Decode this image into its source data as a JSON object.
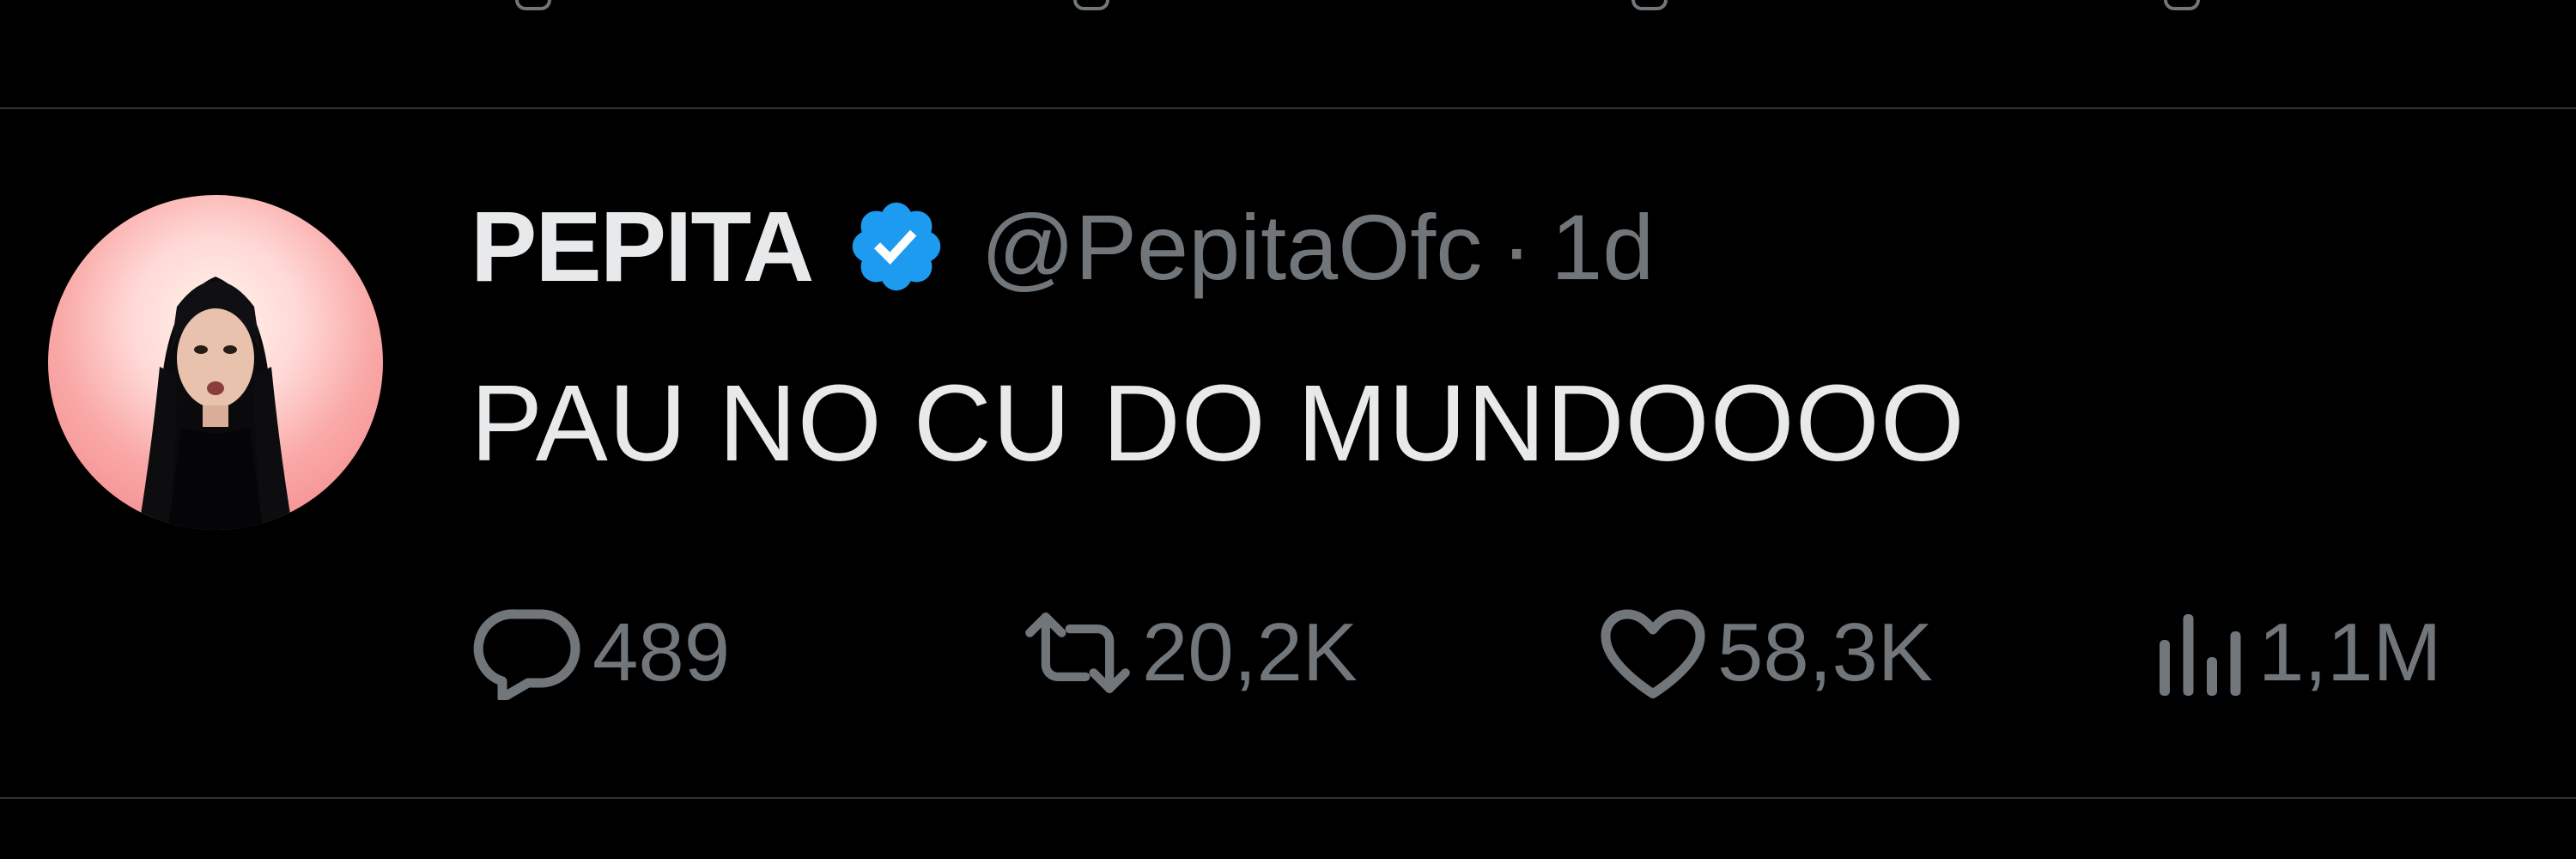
{
  "tweet": {
    "display_name": "PEPITA",
    "verified": true,
    "verified_icon": "verified-badge-icon",
    "handle": "@PepitaOfc",
    "separator": "·",
    "time": "1d",
    "text": "PAU NO CU DO MUNDOOOO"
  },
  "actions": {
    "reply": {
      "icon": "reply-icon",
      "count": "489"
    },
    "retweet": {
      "icon": "retweet-icon",
      "count": "20,2K"
    },
    "like": {
      "icon": "heart-icon",
      "count": "58,3K"
    },
    "views": {
      "icon": "analytics-icon",
      "count": "1,1M"
    }
  },
  "colors": {
    "background": "#000000",
    "primary_text": "#e7e9ea",
    "secondary_text": "#71767b",
    "divider": "#2f3336",
    "verified_blue": "#1d9bf0"
  }
}
